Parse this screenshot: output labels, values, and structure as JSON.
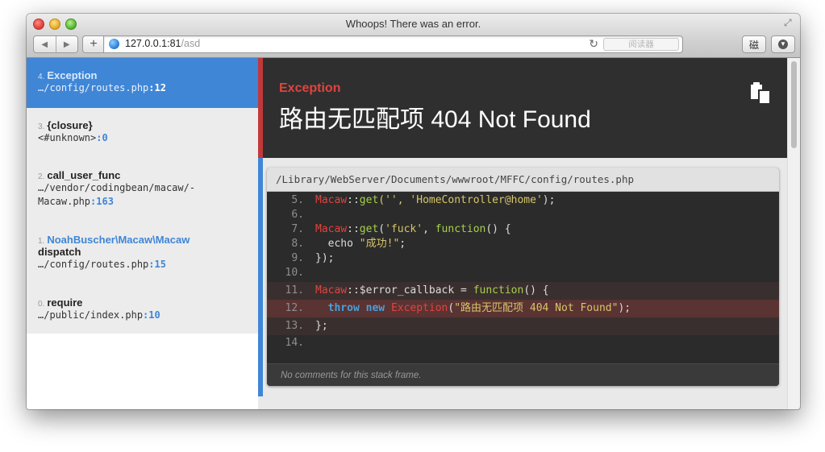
{
  "window": {
    "title": "Whoops! There was an error.",
    "url_host": "127.0.0.1:81",
    "url_path": "/asd",
    "reader_label": "阅读器",
    "extension_label": "磁"
  },
  "exception": {
    "class": "Exception",
    "message": "路由无匹配项 404 Not Found"
  },
  "frames": [
    {
      "index": "4.",
      "class": "Exception",
      "file": "…/config/routes.php",
      "line": ":12"
    },
    {
      "index": "3.",
      "class": "{closure}",
      "file": "<#unknown>",
      "line": ":0"
    },
    {
      "index": "2.",
      "class": "call_user_func",
      "file_line1": "…/vendor/codingbean/macaw/-",
      "file": "Macaw.php",
      "line": ":163"
    },
    {
      "index": "1.",
      "class_ns": "NoahBuscher\\Macaw\\Macaw",
      "class": "dispatch",
      "file": "…/config/routes.php",
      "line": ":15"
    },
    {
      "index": "0.",
      "class": "require",
      "file": "…/public/index.php",
      "line": ":10"
    }
  ],
  "code": {
    "file_path": "/Library/WebServer/Documents/wwwroot/MFFC/config/routes.php",
    "lines": [
      {
        "num": "5."
      },
      {
        "num": "6."
      },
      {
        "num": "7."
      },
      {
        "num": "8."
      },
      {
        "num": "9."
      },
      {
        "num": "10."
      },
      {
        "num": "11."
      },
      {
        "num": "12."
      },
      {
        "num": "13."
      },
      {
        "num": "14."
      }
    ],
    "tokens": {
      "l5": [
        "Macaw",
        "::",
        "get",
        "('', ",
        "'HomeController@home'",
        ");"
      ],
      "l7": [
        "Macaw",
        "::",
        "get",
        "(",
        "'fuck'",
        ", ",
        "function",
        "() {"
      ],
      "l8": [
        "  echo ",
        "\"成功!\"",
        ";"
      ],
      "l9": [
        "});"
      ],
      "l11": [
        "Macaw",
        "::",
        "$error_callback = ",
        "function",
        "() {"
      ],
      "l12": [
        "  ",
        "throw",
        " ",
        "new",
        " ",
        "Exception",
        "(",
        "\"路由无匹配项 404 Not Found\"",
        ");"
      ],
      "l13": [
        "};"
      ]
    },
    "comments_note": "No comments for this stack frame."
  }
}
